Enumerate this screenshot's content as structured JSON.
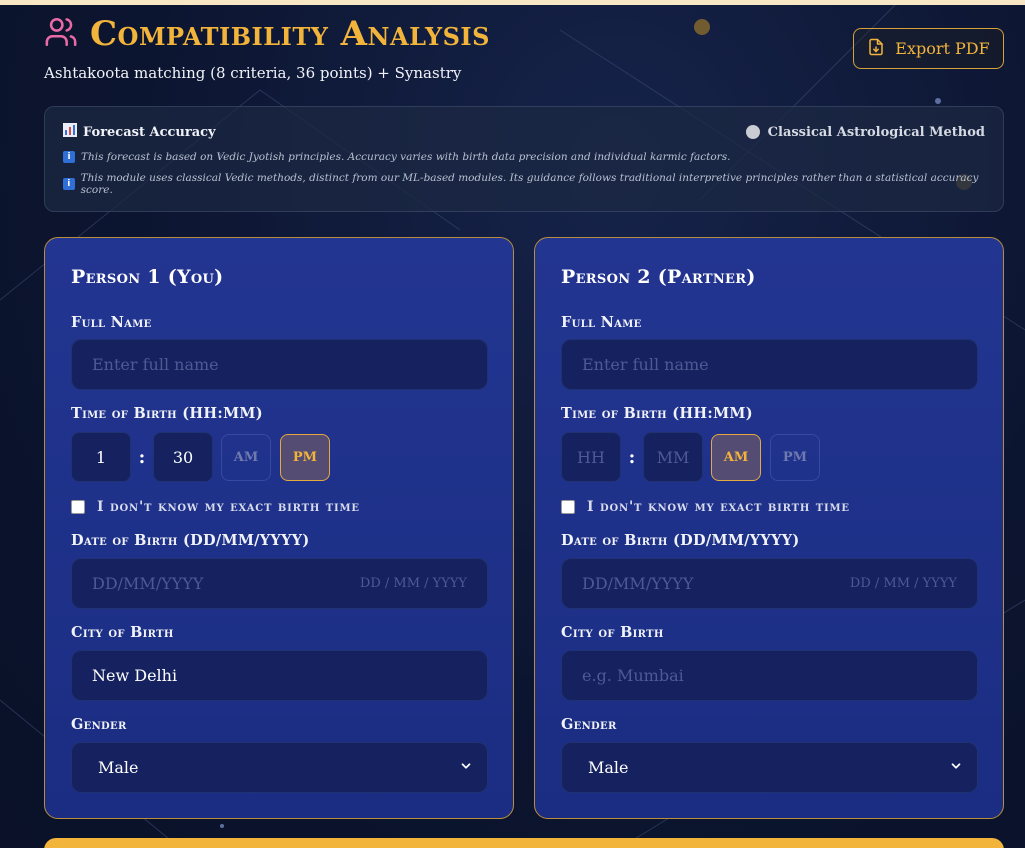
{
  "header": {
    "title": "Compatibility Analysis",
    "subtitle": "Ashtakoota matching (8 criteria, 36 points) + Synastry",
    "export_label": "Export PDF"
  },
  "accuracy": {
    "title": "Forecast Accuracy",
    "method": "Classical Astrological Method",
    "note1": "This forecast is based on Vedic Jyotish principles. Accuracy varies with birth data precision and individual karmic factors.",
    "note2": "This module uses classical Vedic methods, distinct from our ML-based modules. Its guidance follows traditional interpretive principles rather than a statistical accuracy score."
  },
  "labels": {
    "full_name": "Full Name",
    "time_of_birth": "Time of Birth (HH:MM)",
    "unknown_time": "I don't know my exact birth time",
    "date_of_birth": "Date of Birth (DD/MM/YYYY)",
    "city_of_birth": "City of Birth",
    "gender": "Gender",
    "am": "AM",
    "pm": "PM",
    "colon": ":"
  },
  "person1": {
    "title": "Person 1 (You)",
    "name_placeholder": "Enter full name",
    "hour": "1",
    "minute": "30",
    "selected_period": "PM",
    "date_placeholder": "DD/MM/YYYY",
    "date_hint": "DD / MM / YYYY",
    "city": "New Delhi",
    "gender": "Male"
  },
  "person2": {
    "title": "Person 2 (Partner)",
    "name_placeholder": "Enter full name",
    "hour_placeholder": "HH",
    "minute_placeholder": "MM",
    "selected_period": "AM",
    "date_placeholder": "DD/MM/YYYY",
    "date_hint": "DD / MM / YYYY",
    "city_placeholder": "e.g. Mumbai",
    "gender": "Male"
  },
  "colors": {
    "accent_gold": "#f2b43a",
    "panel_blue": "#223591",
    "field_blue": "#15225f",
    "header_icon_pink": "#e86aa6"
  },
  "icons": {
    "header": "users-icon",
    "export": "file-download-icon",
    "accuracy": "bar-chart-icon",
    "info": "info-icon",
    "select": "chevron-down-icon"
  }
}
